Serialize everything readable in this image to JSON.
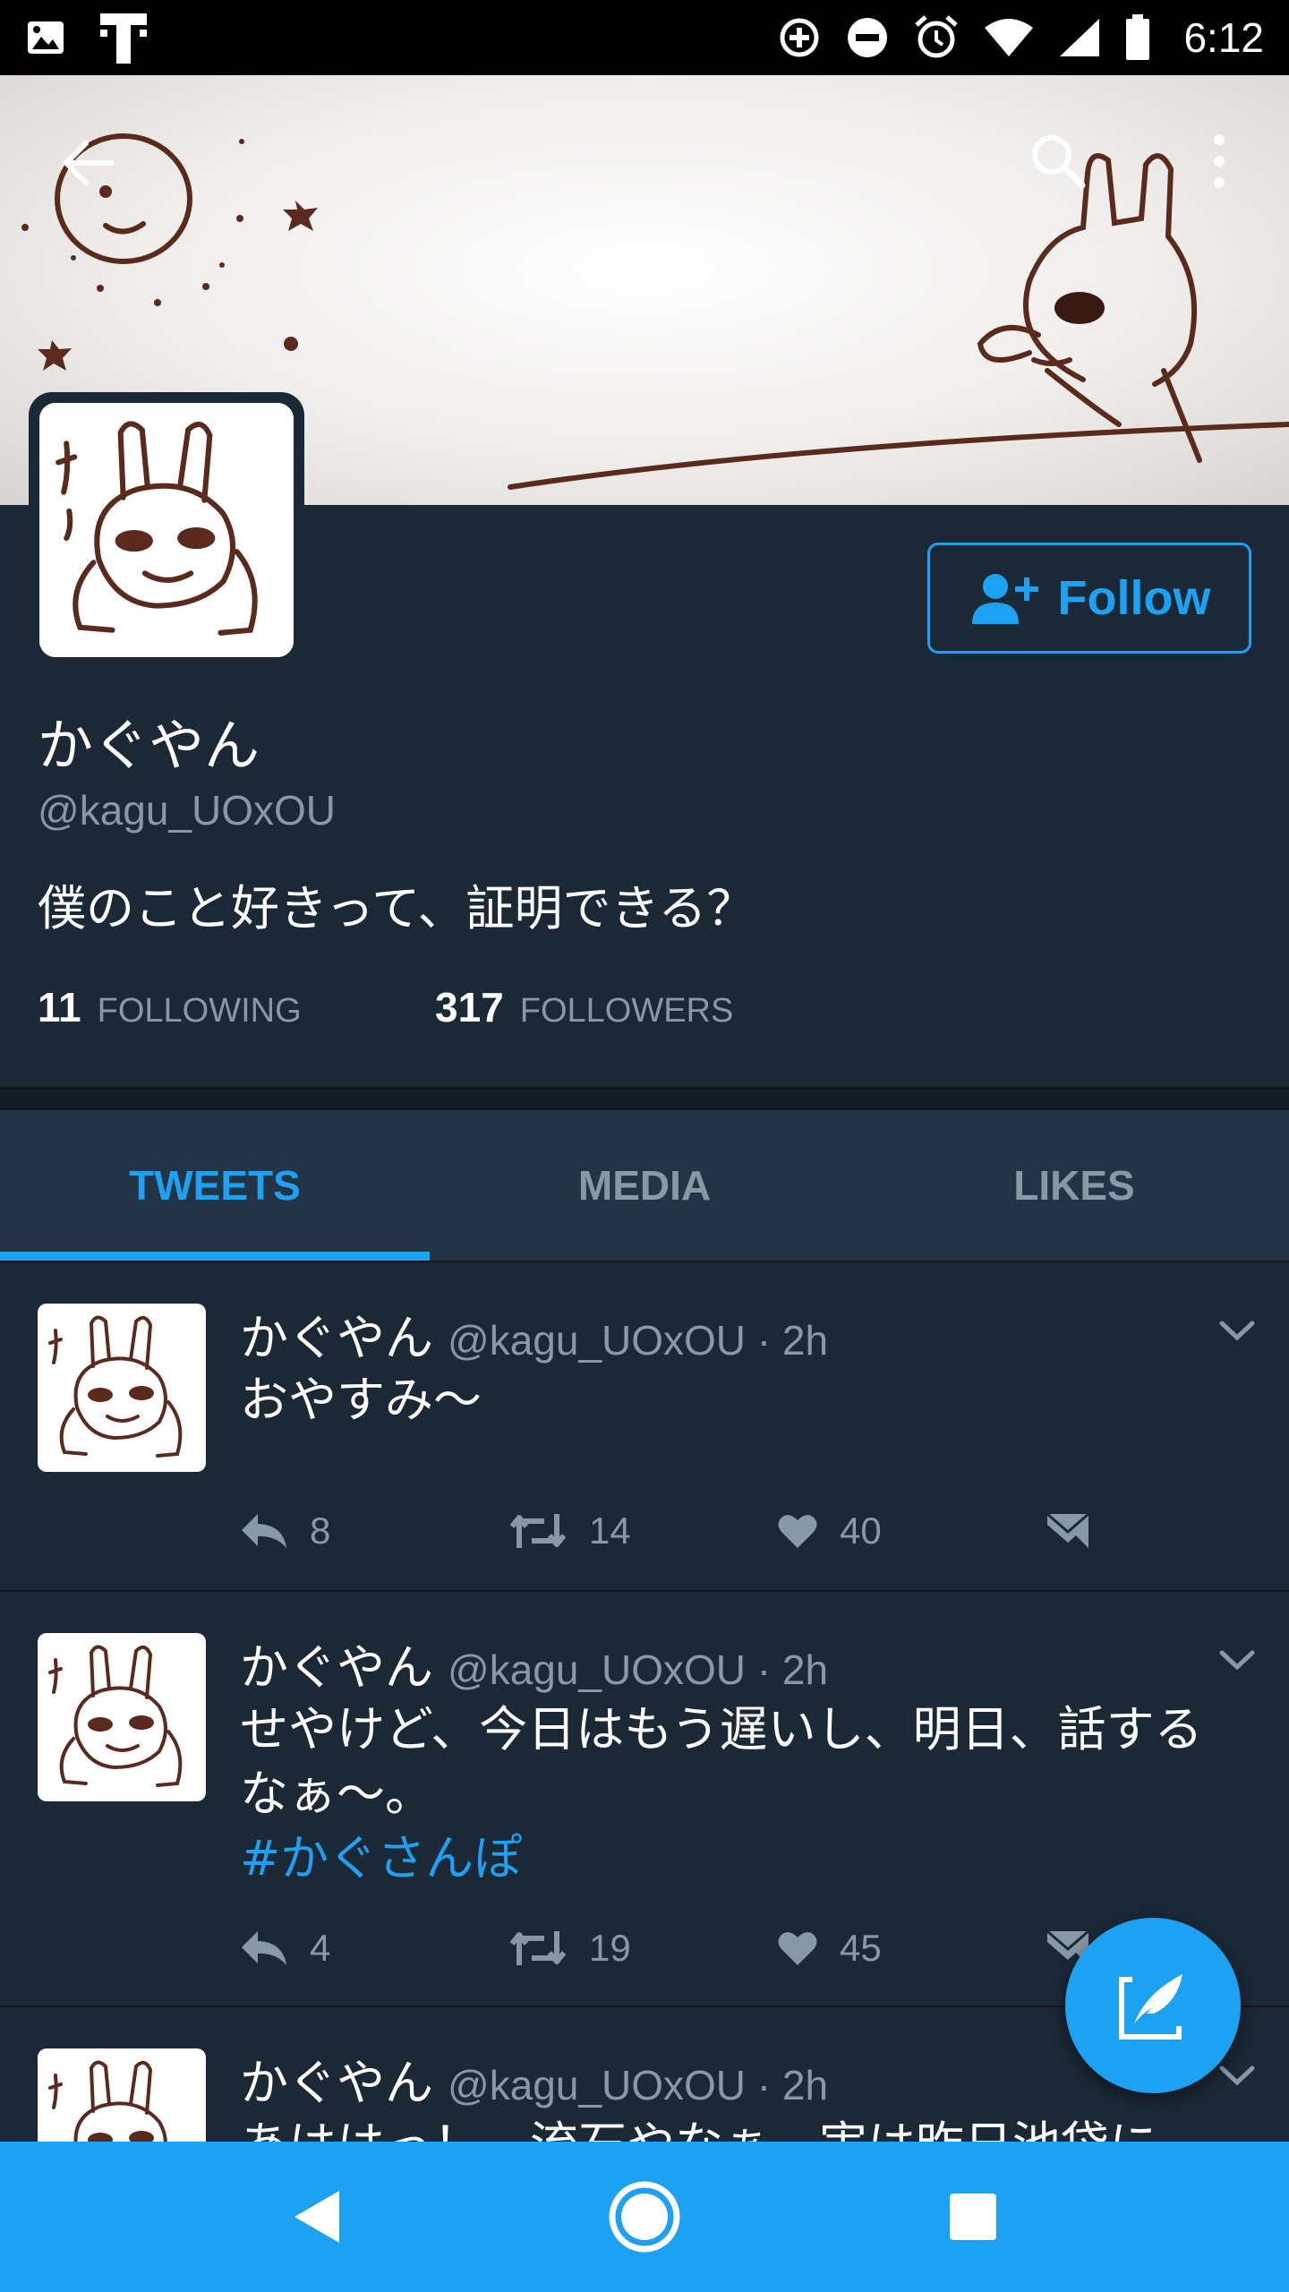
{
  "status_bar": {
    "time": "6:12"
  },
  "profile": {
    "display_name": "かぐやん",
    "handle": "@kagu_UOxOU",
    "bio": "僕のこと好きって、証明できる？",
    "following_count": "11",
    "following_label": "FOLLOWING",
    "followers_count": "317",
    "followers_label": "FOLLOWERS",
    "follow_label": "Follow"
  },
  "tabs": [
    {
      "label": "TWEETS",
      "active": true
    },
    {
      "label": "MEDIA",
      "active": false
    },
    {
      "label": "LIKES",
      "active": false
    }
  ],
  "tweets": [
    {
      "name": "かぐやん",
      "meta": "@kagu_UOxOU · 2h",
      "text": "おやすみ〜",
      "hashtag": "",
      "replies": "8",
      "retweets": "14",
      "likes": "40"
    },
    {
      "name": "かぐやん",
      "meta": "@kagu_UOxOU · 2h",
      "text": "せやけど、今日はもう遅いし、明日、話するなぁ〜。",
      "hashtag": "#かぐさんぽ",
      "replies": "4",
      "retweets": "19",
      "likes": "45"
    },
    {
      "name": "かぐやん",
      "meta": "@kagu_UOxOU · 2h",
      "text": "あははっ！　流石やなぁ、実は昨日池袋に"
    }
  ],
  "colors": {
    "accent": "#1da1f2",
    "background": "#1b2836",
    "tab_bar": "#243447",
    "secondary_text": "#8899a6"
  }
}
